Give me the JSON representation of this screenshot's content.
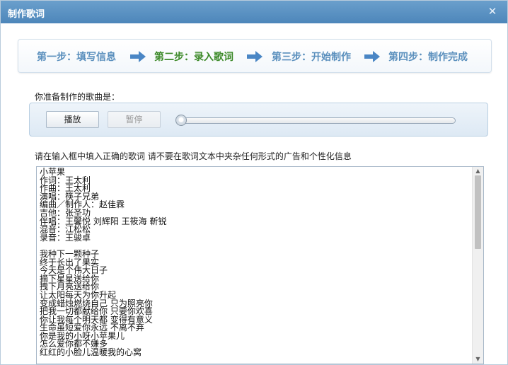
{
  "window": {
    "title": "制作歌词"
  },
  "steps": [
    {
      "label": "第一步：填写信息",
      "active": false
    },
    {
      "label": "第二步：录入歌词",
      "active": true
    },
    {
      "label": "第三步：开始制作",
      "active": false
    },
    {
      "label": "第四步：制作完成",
      "active": false
    }
  ],
  "song_label": "你准备制作的歌曲是：",
  "player": {
    "play_label": "播放",
    "pause_label": "暂停",
    "progress": 0
  },
  "hint": "请在输入框中填入正确的歌词  请不要在歌词文本中夹杂任何形式的广告和个性化信息",
  "lyrics": "小苹果\n作词：王太利\n作曲：王太利\n演唱：筷子兄弟\n编曲／制作人：赵佳霖\n吉他：张圣功\n伴唱：王馨悦 刘辉阳 王筱海 靳锐\n混音：江松松\n录音：王骏卓\n\n我种下一颗种子\n终于长出了果实\n今天是个伟大日子\n摘下星星送给你\n拽下月亮送给你\n让太阳每天为你升起\n变成蜡烛燃烧自己 只为照亮你\n把我一切都献给你 只要你欢喜\n你让我每个明天都 变得有意义\n生命虽短爱你永远 不离不弃\n你是我的小呀小苹果儿\n怎么爱你都不嫌多\n红红的小脸儿温暖我的心窝",
  "colors": {
    "title_bar": "#5a93c4",
    "step": "#5a8fbd",
    "step_active": "#3d8a2a",
    "arrow": "#4a86c5"
  }
}
